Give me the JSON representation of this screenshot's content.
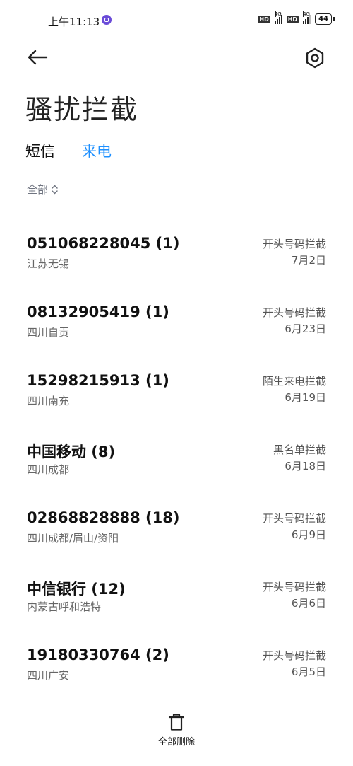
{
  "status_bar": {
    "time": "上午11:13",
    "hd1": "HD",
    "net1": "4G",
    "hd2": "HD",
    "net2": "4G",
    "battery": "44"
  },
  "header": {
    "back_icon": "arrow-left-icon",
    "settings_icon": "hexagon-settings-icon"
  },
  "page_title": "骚扰拦截",
  "tabs": [
    {
      "label": "短信",
      "active": false
    },
    {
      "label": "来电",
      "active": true
    }
  ],
  "colors": {
    "accent": "#1e90ff"
  },
  "filter": {
    "label": "全部"
  },
  "records": [
    {
      "number": "051068228045 (1)",
      "location": "江苏无锡",
      "type": "开头号码拦截",
      "date": "7月2日"
    },
    {
      "number": "08132905419 (1)",
      "location": "四川自贡",
      "type": "开头号码拦截",
      "date": "6月23日"
    },
    {
      "number": "15298215913 (1)",
      "location": "四川南充",
      "type": "陌生来电拦截",
      "date": "6月19日"
    },
    {
      "number": "中国移动 (8)",
      "location": "四川成都",
      "type": "黑名单拦截",
      "date": "6月18日"
    },
    {
      "number": "02868828888 (18)",
      "location": "四川成都/眉山/资阳",
      "type": "开头号码拦截",
      "date": "6月9日"
    },
    {
      "number": "中信银行 (12)",
      "location": "内蒙古呼和浩特",
      "type": "开头号码拦截",
      "date": "6月6日"
    },
    {
      "number": "19180330764 (2)",
      "location": "四川广安",
      "type": "开头号码拦截",
      "date": "6月5日"
    }
  ],
  "footer": {
    "delete_all_label": "全部删除",
    "icon": "trash-icon"
  }
}
